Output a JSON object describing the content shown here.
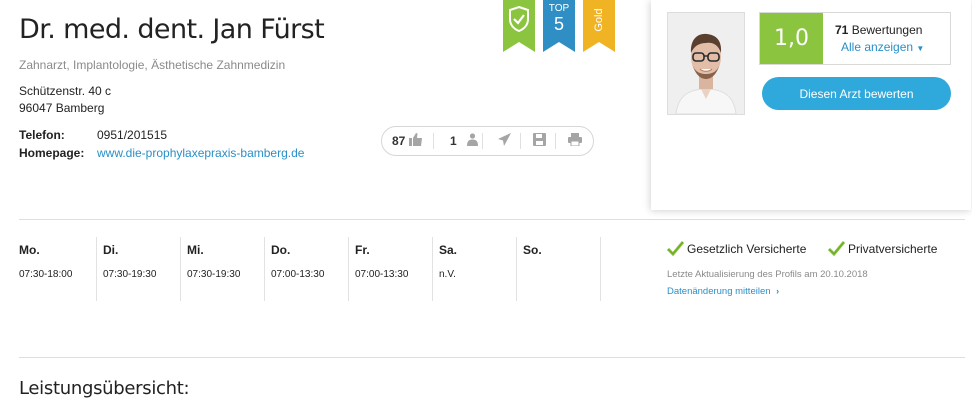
{
  "doctor": {
    "name": "Dr. med. dent. Jan Fürst",
    "specialties": "Zahnarzt, Implantologie, Ästhetische Zahnmedizin",
    "street": "Schützenstr. 40 c",
    "city": "96047 Bamberg",
    "phone_label": "Telefon:",
    "phone": "0951/201515",
    "homepage_label": "Homepage:",
    "homepage": "www.die-prophylaxepraxis-bamberg.de"
  },
  "badges": {
    "top_label": "TOP",
    "top_number": "5",
    "gold_label": "Gold"
  },
  "actions": {
    "likes": "87",
    "followers": "1"
  },
  "rating": {
    "grade": "1,0",
    "count": "71",
    "count_suffix": "Bewertungen",
    "show_all": "Alle anzeigen",
    "rate_button": "Diesen Arzt bewerten"
  },
  "hours": {
    "days": [
      {
        "name": "Mo.",
        "time": "07:30-18:00"
      },
      {
        "name": "Di.",
        "time": "07:30-19:30"
      },
      {
        "name": "Mi.",
        "time": "07:30-19:30"
      },
      {
        "name": "Do.",
        "time": "07:00-13:30"
      },
      {
        "name": "Fr.",
        "time": "07:00-13:30"
      },
      {
        "name": "Sa.",
        "time": "n.V."
      },
      {
        "name": "So.",
        "time": ""
      }
    ]
  },
  "insurance": {
    "public": "Gesetzlich Versicherte",
    "private": "Privatversicherte",
    "updated": "Letzte Aktualisierung des Profils am 20.10.2018",
    "change_link": "Datenänderung mitteilen"
  },
  "section": {
    "title": "Leistungsübersicht:"
  },
  "colors": {
    "green": "#8bc53f",
    "blue": "#2fa8dc",
    "link": "#2a8fc7",
    "gold": "#f0b323",
    "top_blue": "#2f8fc5"
  }
}
